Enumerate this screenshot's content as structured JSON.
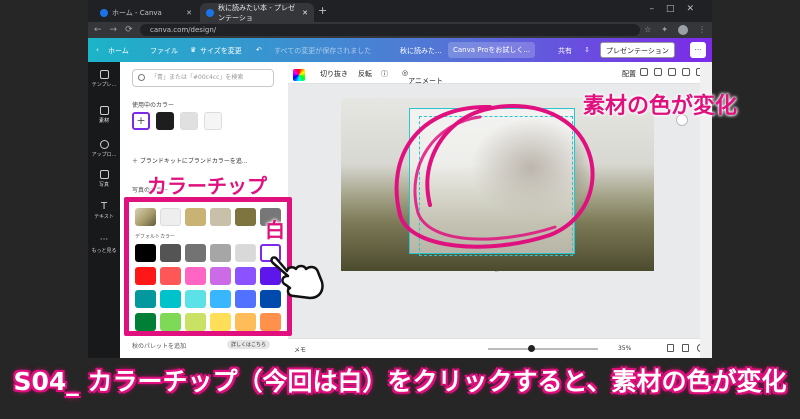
{
  "browser": {
    "tabs": [
      {
        "label": "ホーム - Canva"
      },
      {
        "label": "秋に読みたい本 - プレゼンテーショ"
      }
    ],
    "address": "canva.com/design/"
  },
  "canva_top": {
    "home": "ホーム",
    "file": "ファイル",
    "resize": "サイズを変更",
    "saved": "すべての変更が保存されました",
    "doc_title": "秋に読みた...",
    "pro": "Canva Proをお試しく...",
    "share": "共有",
    "present": "プレゼンテーション"
  },
  "iconbar": [
    {
      "label": "テンプレ..."
    },
    {
      "label": "素材"
    },
    {
      "label": "アップロ..."
    },
    {
      "label": "写真"
    },
    {
      "label": "テキスト"
    },
    {
      "label": "もっと見る"
    }
  ],
  "panel": {
    "search_placeholder": "「青」または「#00c4cc」を検索",
    "used_colors_label": "使用中のカラー",
    "brand_kit": "ブランドキットにブランドカラーを追...",
    "photo_colors_label": "写真のカラー",
    "default_colors_label": "デフォルトカラー",
    "footer": "秋のパレットを追加",
    "footer_badge": "詳しくはこちら",
    "used_colors": [
      "#1e1e1e",
      "#e0e0e0",
      "#f5f5f5"
    ],
    "photo_colors": [
      "#a89c6a",
      "#eeeeee",
      "#c9b374",
      "#c8c0a8",
      "#7d7440",
      "#777777"
    ],
    "default_colors": [
      [
        "#000000",
        "#545454",
        "#737373",
        "#a6a6a6",
        "#d9d9d9",
        "#ffffff"
      ],
      [
        "#ff1616",
        "#ff5757",
        "#ff66c4",
        "#cb6ce6",
        "#8c52ff",
        "#5e17eb"
      ],
      [
        "#03989e",
        "#00c2cb",
        "#5ce1e6",
        "#38b6ff",
        "#5271ff",
        "#004aad"
      ],
      [
        "#008037",
        "#7ed957",
        "#c9e265",
        "#ffde59",
        "#ffbd59",
        "#ff914d"
      ]
    ]
  },
  "toolbar": {
    "crop": "切り抜き",
    "flip": "反転",
    "animate": "アニメート",
    "arrange": "配置"
  },
  "bottom": {
    "memo": "メモ",
    "zoom": "35%"
  },
  "annotations": {
    "material_color": "素材の色が変化",
    "color_chip": "カラーチップ",
    "white": "白",
    "caption": "S04_ カラーチップ（今回は白）をクリックすると、素材の色が変化"
  },
  "colors": {
    "accent": "#e0117f",
    "canva_purple": "#7d2ae8",
    "canva_teal": "#1cb4c8"
  }
}
